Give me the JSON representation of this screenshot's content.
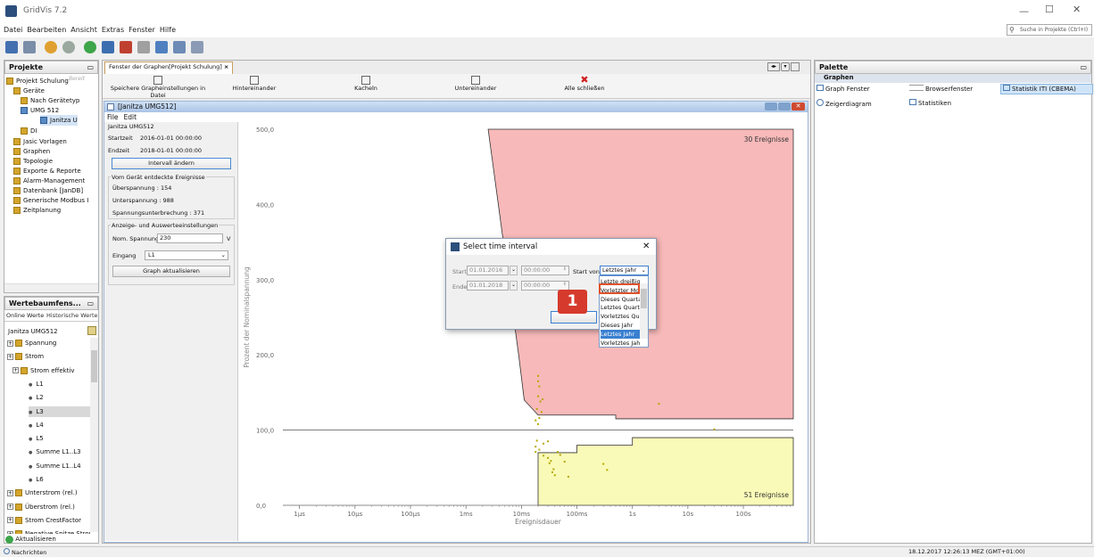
{
  "app": {
    "title": "GridVis 7.2",
    "search_placeholder": "Suche in Projekte (Ctrl+I)",
    "status_time": "18.12.2017 12:26:13 MEZ (GMT+01:00)",
    "messages_label": "Nachrichten"
  },
  "menu": [
    "Datei",
    "Bearbeiten",
    "Ansicht",
    "Extras",
    "Fenster",
    "Hilfe"
  ],
  "projects": {
    "tab": "Projekte",
    "items": [
      "Projekt Schulung",
      "Bereit",
      "Geräte",
      "Nach Gerätetyp",
      "UMG 512",
      "Janitza U",
      "DI",
      "Jasic Vorlagen",
      "Graphen",
      "Topologie",
      "Exporte & Reporte",
      "Alarm-Management",
      "Datenbank [JanDB]",
      "Generische Modbus I",
      "Zeitplanung"
    ]
  },
  "values_tree": {
    "tab": "Wertebaumfens...",
    "tab_online": "Online Werte",
    "tab_history": "Historische Werte",
    "device": "Janitza UMG512",
    "items": [
      "Spannung",
      "Strom",
      "Strom effektiv",
      "L1",
      "L2",
      "L3",
      "L4",
      "L5",
      "Summe L1..L3",
      "Summe L1..L4",
      "L6",
      "Unterstrom (rel.)",
      "Überstrom (rel.)",
      "Strom CrestFactor",
      "Negative Spitze Strom"
    ],
    "refresh": "Aktualisieren"
  },
  "graph_window": {
    "tab": "Fenster der Graphen[Projekt Schulung]",
    "tools": [
      "Speichere Grapheinstellungen in Datei",
      "Hintereinander",
      "Kacheln",
      "Untereinander",
      "Alle schließen"
    ],
    "inner_title": "[Janitza UMG512]",
    "inner_menu": [
      "File",
      "Edit"
    ],
    "device": "Janitza UMG512",
    "start_label": "Startzeit",
    "start": "2016-01-01 00:00:00",
    "end_label": "Endzeit",
    "end": "2018-01-01 00:00:00",
    "interval_btn": "Intervall ändern",
    "events_title": "Vom Gerät entdeckte Ereignisse",
    "events": [
      "Überspannung : 154",
      "Unterspannung : 988",
      "Spannungsunterbrechung : 371"
    ],
    "settings_title": "Anzeige- und Auswerteeinstellungen",
    "nom_label": "Nom. Spannung",
    "nom_value": "230",
    "nom_unit": "V",
    "input_label": "Eingang",
    "input_value": "L1",
    "update_btn": "Graph aktualisieren"
  },
  "chart_data": {
    "type": "scatter",
    "title": "",
    "xlabel": "Ereignisdauer",
    "ylabel": "Prozent der Nominalspannung",
    "x_scale": "log",
    "xlim": [
      "1µs",
      "100s"
    ],
    "ylim": [
      0,
      500
    ],
    "x_ticks": [
      "1µs",
      "10µs",
      "100µs",
      "1ms",
      "10ms",
      "100ms",
      "1s",
      "10s",
      "100s"
    ],
    "y_ticks": [
      "0,0",
      "100,0",
      "200,0",
      "300,0",
      "400,0",
      "500,0"
    ],
    "annotations": [
      "30 Ereignisse",
      "51 Ereignisse"
    ],
    "colors": {
      "upper": "#f7b9b9",
      "lower": "#fafab8",
      "points": "#b5a600"
    },
    "series": [
      {
        "points": [
          [
            0.02,
            172
          ],
          [
            0.02,
            165
          ],
          [
            0.021,
            158
          ],
          [
            0.02,
            145
          ],
          [
            0.022,
            138
          ],
          [
            0.019,
            128
          ],
          [
            0.021,
            116
          ],
          [
            0.018,
            113
          ],
          [
            0.02,
            108
          ],
          [
            0.023,
            124
          ],
          [
            0.024,
            141
          ],
          [
            0.018,
            71
          ],
          [
            0.018,
            78
          ],
          [
            0.019,
            86
          ],
          [
            0.021,
            74
          ],
          [
            0.025,
            66
          ],
          [
            0.03,
            63
          ],
          [
            0.032,
            56
          ],
          [
            0.034,
            59
          ],
          [
            0.038,
            48
          ],
          [
            0.036,
            44
          ],
          [
            0.045,
            71
          ],
          [
            0.05,
            67
          ],
          [
            0.06,
            58
          ],
          [
            0.025,
            82
          ],
          [
            0.03,
            85
          ],
          [
            0.04,
            40
          ],
          [
            0.07,
            38
          ],
          [
            0.3,
            55
          ],
          [
            0.35,
            47
          ],
          [
            3,
            135
          ],
          [
            30,
            101
          ]
        ]
      }
    ]
  },
  "dialog": {
    "title": "Select time interval",
    "start_label": "Start",
    "start_date": "01.01.2016",
    "start_time": "00:00:00",
    "end_label": "Ende",
    "end_date": "01.01.2018",
    "end_time": "00:00:00",
    "start_from_label": "Start von",
    "selected": "Letztes Jahr",
    "options": [
      "Letzte dreißig",
      "Vorletzter Mo",
      "Dieses Quartal",
      "Letztes Quart",
      "Vorletztes Qu",
      "Dieses Jahr",
      "Letztes Jahr",
      "Vorletztes Jah"
    ],
    "badge": "1"
  },
  "palette": {
    "tab": "Palette",
    "group": "Graphen",
    "items": [
      "Graph Fenster",
      "Browserfenster",
      "Statistik ITI (CBEMA)",
      "Zeigerdiagram",
      "Statistiken"
    ]
  }
}
